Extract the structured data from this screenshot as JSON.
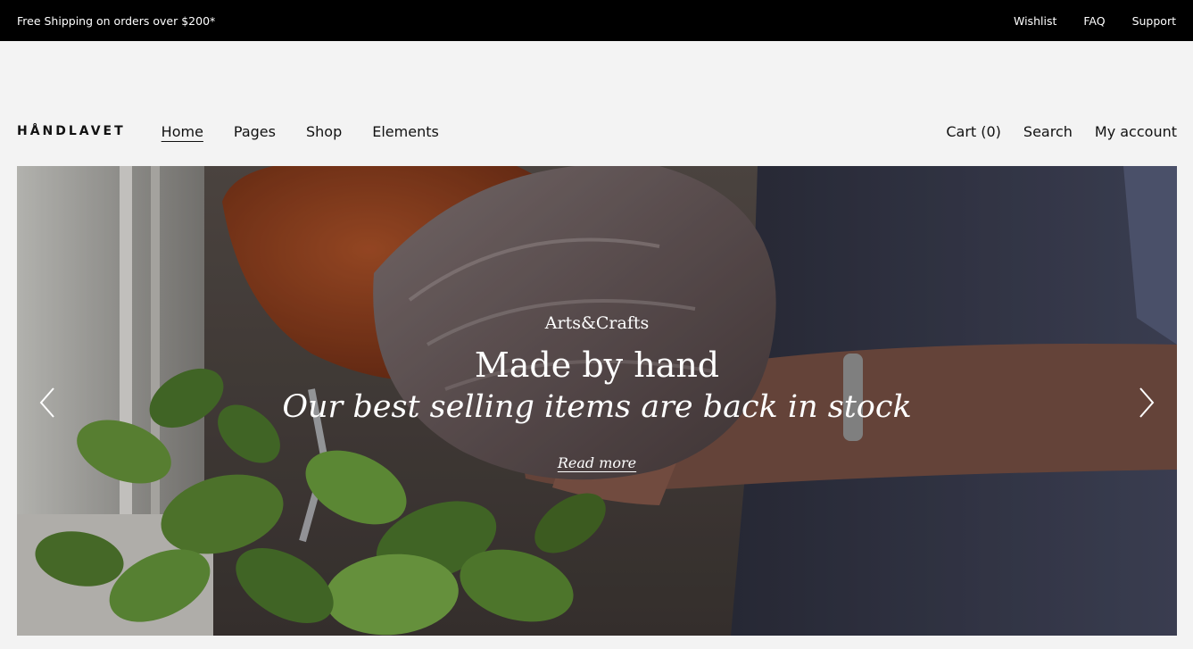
{
  "topbar": {
    "promo": "Free Shipping on orders over $200*",
    "links": [
      "Wishlist",
      "FAQ",
      "Support"
    ]
  },
  "header": {
    "logo": "HÅNDLAVET",
    "nav": [
      "Home",
      "Pages",
      "Shop",
      "Elements"
    ],
    "active_nav": "Home",
    "account": [
      "Cart (0)",
      "Search",
      "My account"
    ]
  },
  "hero": {
    "kicker": "Arts&Crafts",
    "title": "Made by hand",
    "subtitle": "Our best selling items are back in stock",
    "cta": "Read more",
    "prev_icon": "chevron-left-icon",
    "next_icon": "chevron-right-icon"
  },
  "colors": {
    "topbar_bg": "#000000",
    "page_bg": "#f3f3f3",
    "text": "#111111",
    "hero_text": "#ffffff"
  }
}
